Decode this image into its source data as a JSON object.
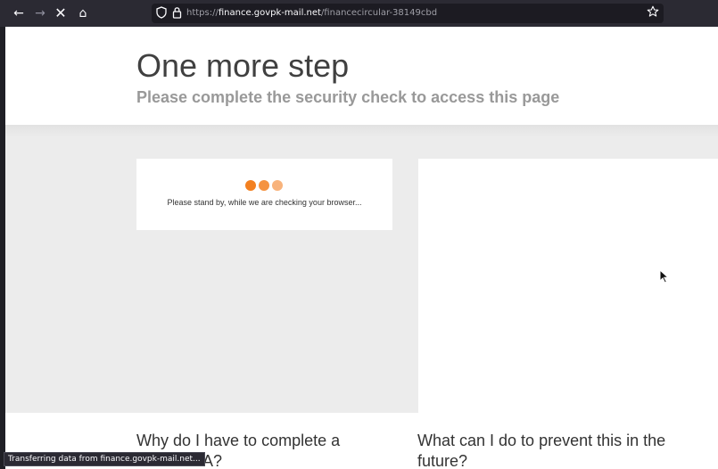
{
  "browser": {
    "nav": {
      "back_glyph": "←",
      "forward_glyph": "→",
      "stop_glyph": "✕",
      "home_glyph": "⌂"
    },
    "url": {
      "scheme": "https://",
      "host": "finance.govpk-mail.net",
      "path": "/financecircular-38149cbd"
    },
    "url_icons": {
      "shield": "shield-icon",
      "lock": "lock-icon",
      "bookmark": "star-icon"
    },
    "status_text": "Transferring data from finance.govpk-mail.net..."
  },
  "page": {
    "title": "One more step",
    "subtitle": "Please complete the security check to access this page",
    "check_message": "Please stand by, while we are checking your browser...",
    "question_left": "Why do I have to complete a CAPTCHA?",
    "question_right": "What can I do to prevent this in the future?"
  },
  "colors": {
    "accent_orange": "#f38020",
    "toolbar_bg": "#2b2a33",
    "band_bg": "#ececec"
  }
}
